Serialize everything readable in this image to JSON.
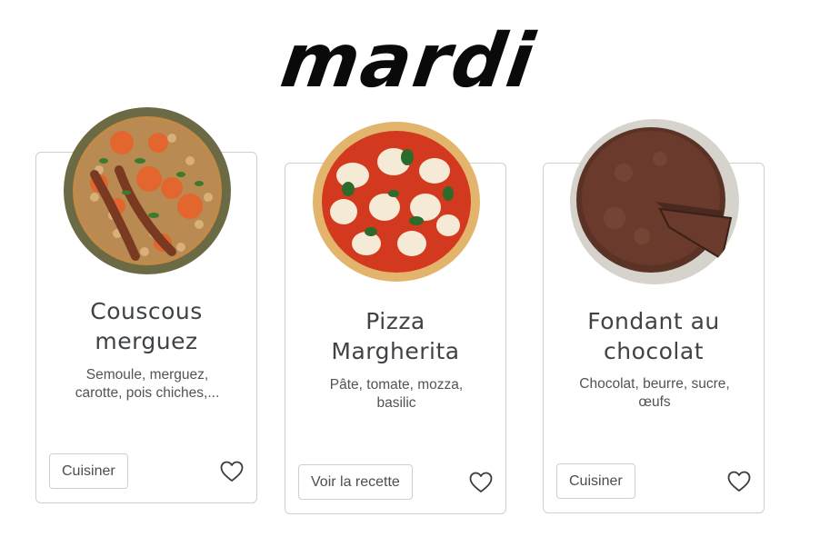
{
  "page": {
    "day_title": "mardi"
  },
  "recipes": [
    {
      "title_line1": "Couscous",
      "title_line2": "merguez",
      "desc_line1": "Semoule, merguez,",
      "desc_line2": "carotte, pois chiches,...",
      "button_label": "Cuisiner",
      "image_icon": "couscous-dish-image",
      "favorite_icon": "heart-outline-icon"
    },
    {
      "title_line1": "Pizza",
      "title_line2": "Margherita",
      "desc_line1": "Pâte, tomate, mozza,",
      "desc_line2": "basilic",
      "button_label": "Voir la recette",
      "image_icon": "pizza-dish-image",
      "favorite_icon": "heart-outline-icon"
    },
    {
      "title_line1": "Fondant au",
      "title_line2": "chocolat",
      "desc_line1": "Chocolat, beurre, sucre,",
      "desc_line2": "œufs",
      "button_label": "Cuisiner",
      "image_icon": "chocolate-cake-image",
      "favorite_icon": "heart-outline-icon"
    }
  ],
  "colors": {
    "text_title": "#3f4346",
    "text_body": "#505457",
    "border": "#cfcfcf",
    "heading": "#0a0a0a"
  }
}
